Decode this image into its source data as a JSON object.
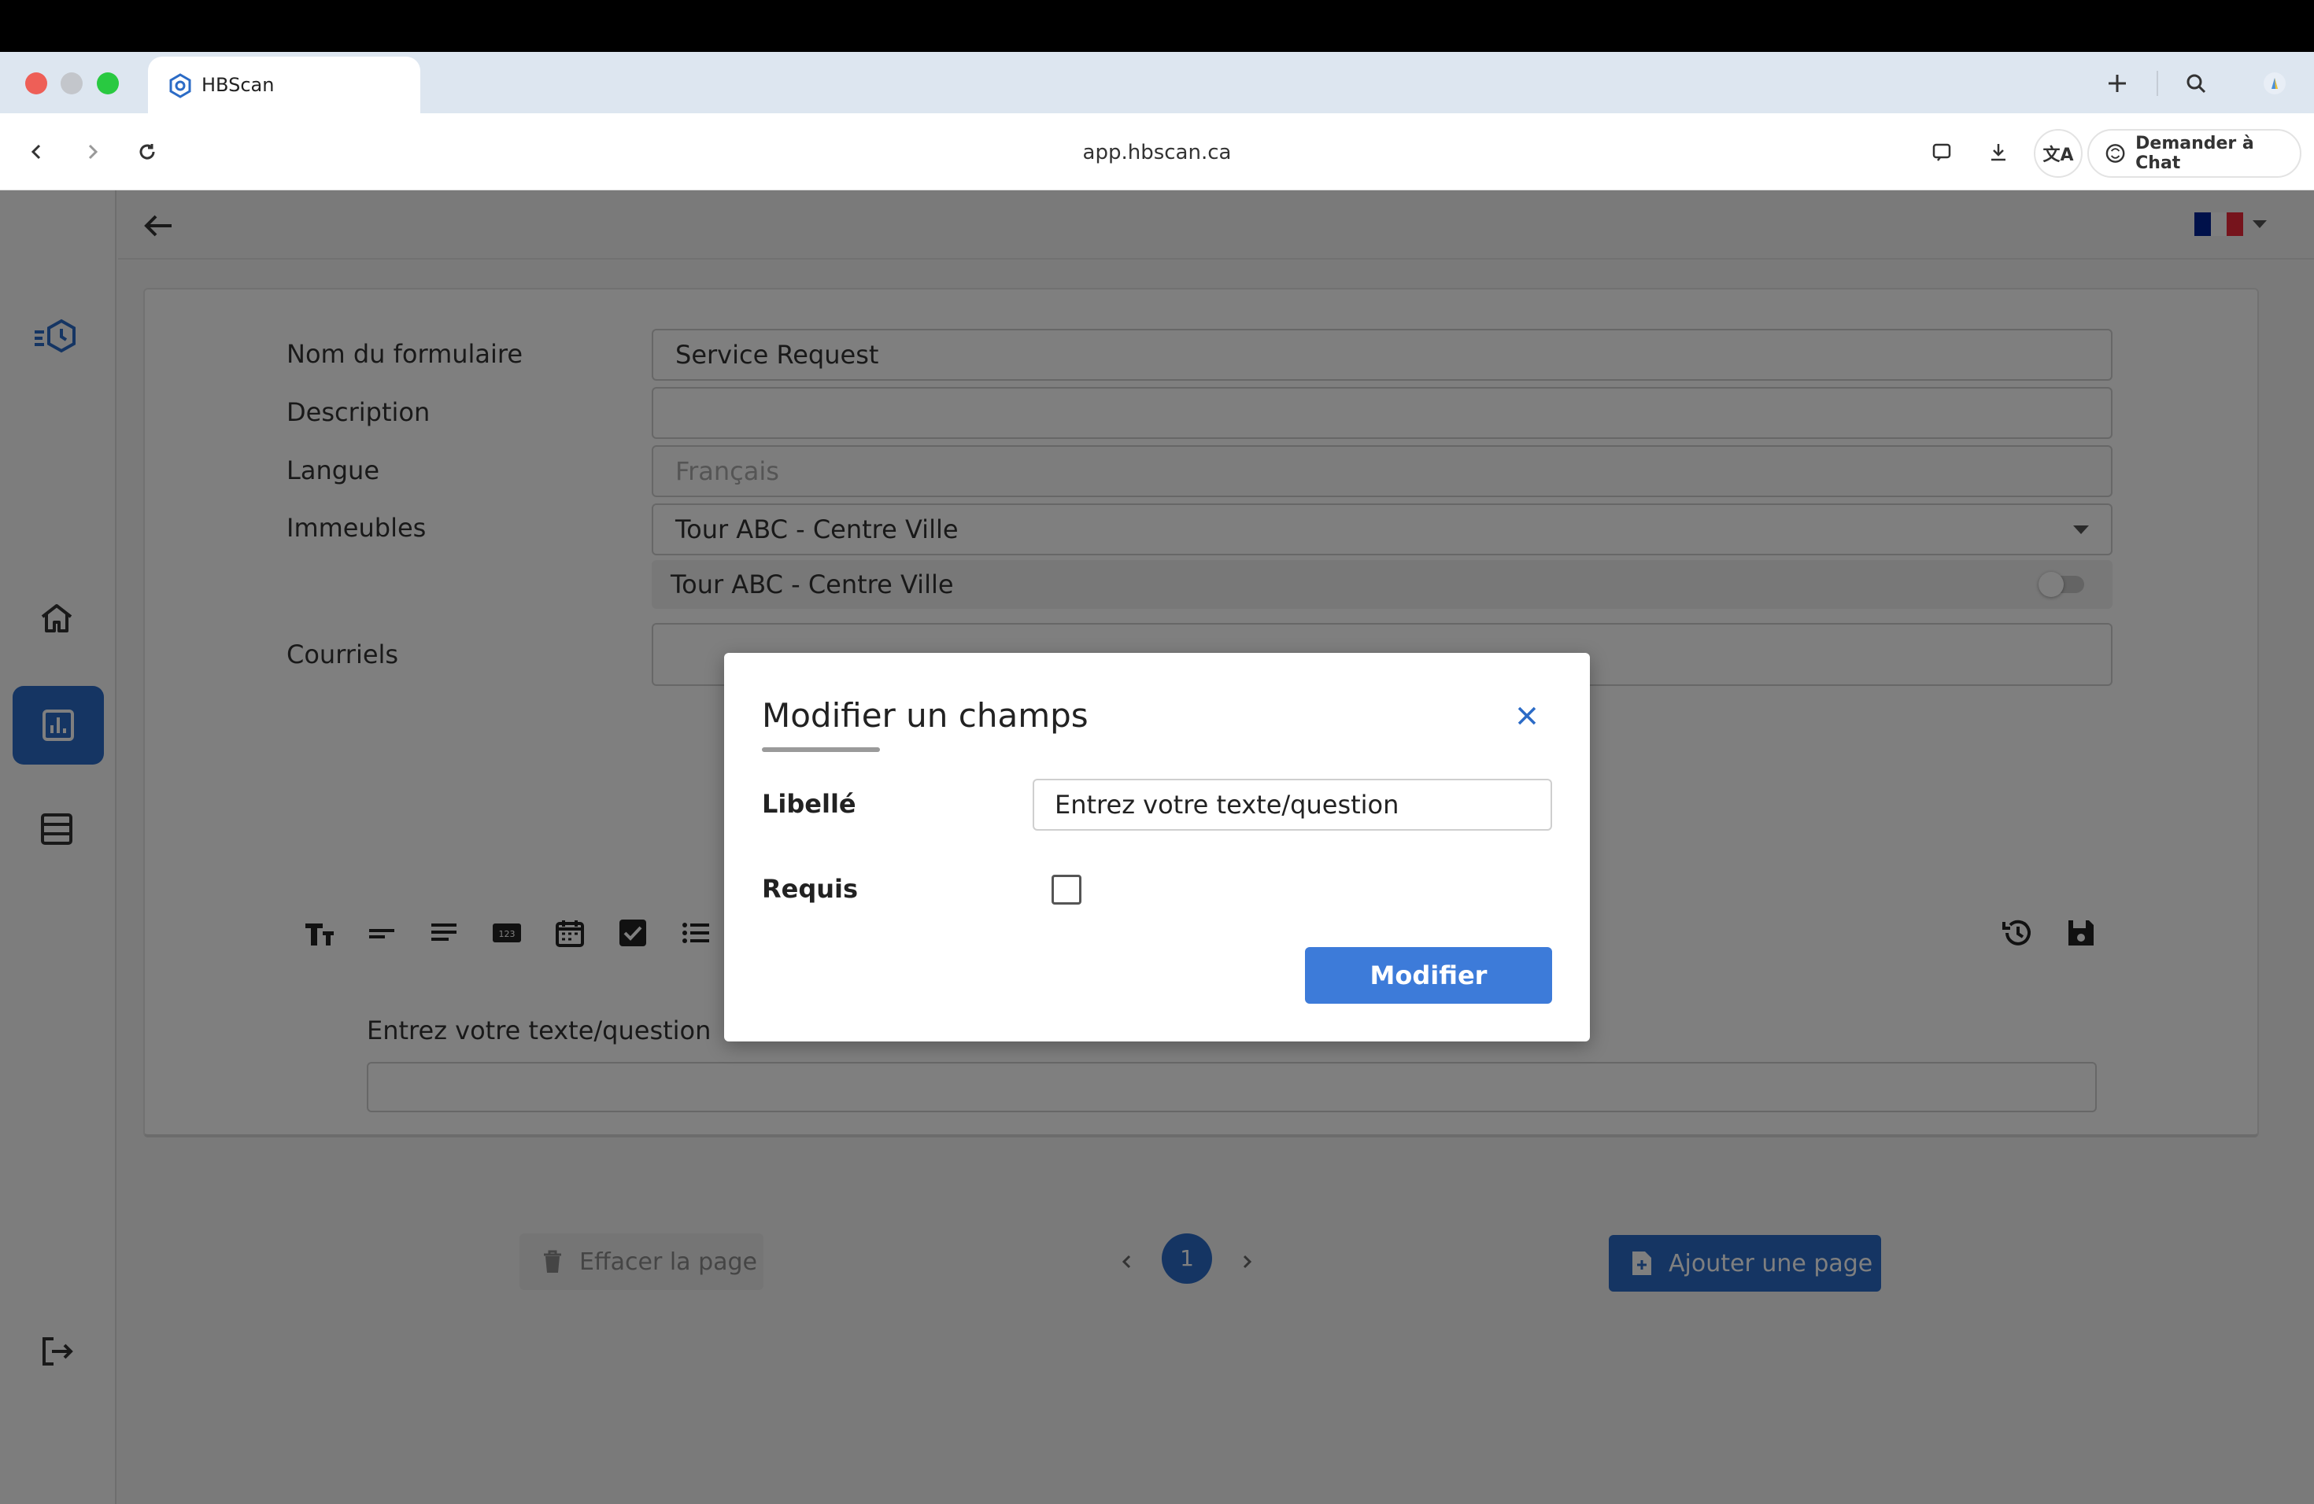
{
  "browser": {
    "tab_title": "HBScan",
    "url": "app.hbscan.ca",
    "chat_button_label": "Demander à Chat",
    "translate_label": "文A"
  },
  "form": {
    "name_label": "Nom du formulaire",
    "name_value": "Service Request",
    "description_label": "Description",
    "description_value": "",
    "language_label": "Langue",
    "language_value": "Français",
    "buildings_label": "Immeubles",
    "buildings_value": "Tour ABC - Centre Ville",
    "buildings_selected": [
      {
        "name": "Tour ABC - Centre Ville",
        "enabled": false
      }
    ],
    "emails_label": "Courriels",
    "emails_value": "",
    "tool_123_label": "123",
    "question_label": "Entrez votre texte/question",
    "clear_page_label": "Effacer la page",
    "add_page_label": "Ajouter une page",
    "current_page": "1"
  },
  "modal": {
    "title": "Modifier un champs",
    "label_field_label": "Libellé",
    "label_field_value": "Entrez votre texte/question",
    "required_label": "Requis",
    "required_checked": false,
    "submit_label": "Modifier"
  },
  "colors": {
    "primary": "#2b6bc6",
    "modal_button": "#3d7bd9",
    "flag_blue": "#002395",
    "flag_red": "#ED2939"
  }
}
